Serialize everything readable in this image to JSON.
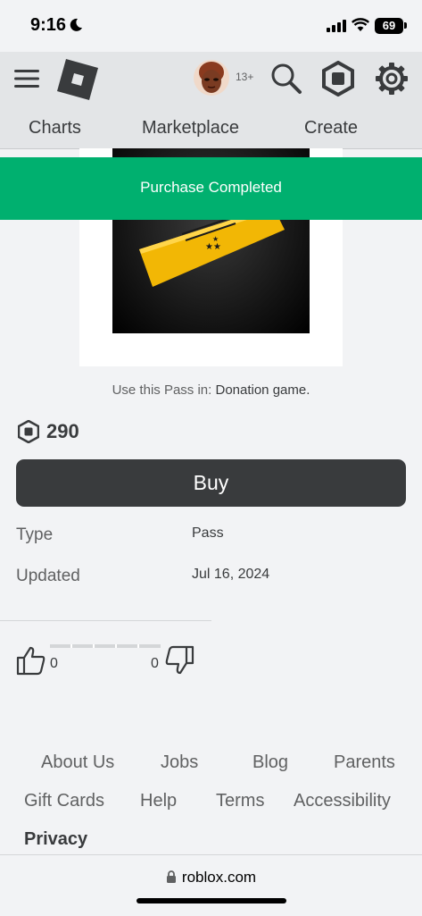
{
  "status_bar": {
    "time": "9:16",
    "battery": "69"
  },
  "header": {
    "age_badge": "13+"
  },
  "nav_tabs": [
    {
      "label": "Charts"
    },
    {
      "label": "Marketplace"
    },
    {
      "label": "Create"
    }
  ],
  "toast": {
    "message": "Purchase Completed"
  },
  "item": {
    "use_pass_prefix": "Use this Pass in: ",
    "game_name": "Donation game.",
    "price": "290",
    "buy_label": "Buy",
    "details": [
      {
        "label": "Type",
        "value": "Pass"
      },
      {
        "label": "Updated",
        "value": "Jul 16, 2024"
      }
    ],
    "votes": {
      "up": "0",
      "down": "0"
    }
  },
  "footer": {
    "links": [
      "About Us",
      "Jobs",
      "Blog",
      "Parents",
      "Gift Cards",
      "Help",
      "Terms",
      "Accessibility",
      "Privacy"
    ]
  },
  "browser": {
    "url": "roblox.com"
  },
  "colors": {
    "toast": "#00b06f",
    "buy_button": "#393b3d",
    "ticket": "#f2b705"
  }
}
